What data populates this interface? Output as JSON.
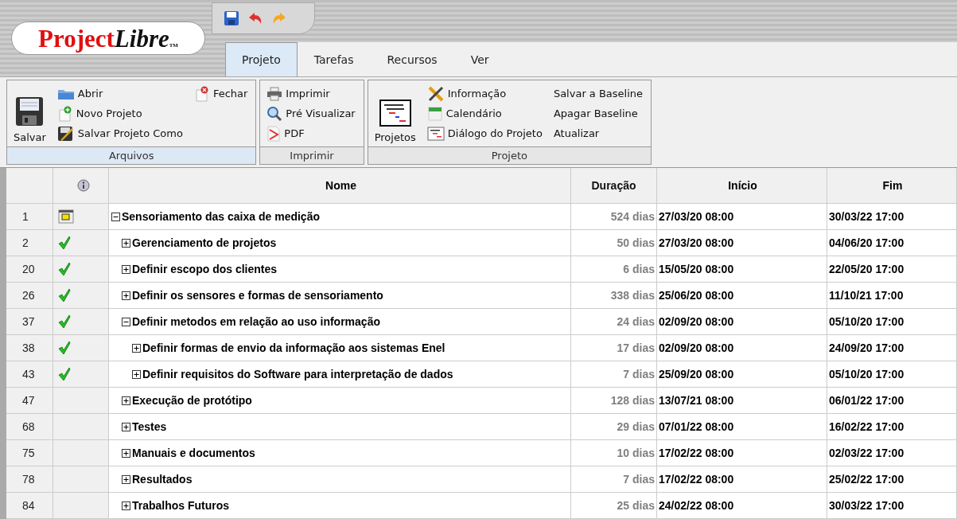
{
  "logo": {
    "first": "Project",
    "second": "Libre",
    "mark": "TM"
  },
  "tabs": [
    {
      "label": "Projeto",
      "selected": true
    },
    {
      "label": "Tarefas",
      "selected": false
    },
    {
      "label": "Recursos",
      "selected": false
    },
    {
      "label": "Ver",
      "selected": false
    }
  ],
  "ribbon": {
    "groups": [
      {
        "label": "Arquivos",
        "large": "Salvar",
        "columns": [
          [
            "Abrir",
            "Novo Projeto",
            "Salvar Projeto Como"
          ],
          [
            "Fechar"
          ]
        ]
      },
      {
        "label": "Imprimir",
        "columns": [
          [
            "Imprimir",
            "Pré Visualizar",
            "PDF"
          ]
        ]
      },
      {
        "label": "Projeto",
        "large": "Projetos",
        "columns": [
          [
            "Informação",
            "Calendário",
            "Diálogo do Projeto"
          ],
          [
            "Salvar a Baseline",
            "Apagar Baseline",
            "Atualizar"
          ]
        ]
      }
    ]
  },
  "table": {
    "columns": [
      "Nome",
      "Duração",
      "Início",
      "Fim"
    ],
    "rows": [
      {
        "id": "1",
        "kind": "calendar",
        "name": "Sensoriamento das caixa de medição",
        "expanded": true,
        "duration": "524 dias",
        "start": "27/03/20 08:00",
        "finish": "30/03/22 17:00",
        "children": [
          {
            "id": "2",
            "kind": "done",
            "name": "Gerenciamento de projetos",
            "expanded": false,
            "duration": "50 dias",
            "start": "27/03/20 08:00",
            "finish": "04/06/20 17:00"
          },
          {
            "id": "20",
            "kind": "done",
            "name": "Definir escopo dos clientes",
            "expanded": false,
            "duration": "6 dias",
            "start": "15/05/20 08:00",
            "finish": "22/05/20 17:00"
          },
          {
            "id": "26",
            "kind": "done",
            "name": "Definir os sensores e formas de sensoriamento",
            "expanded": false,
            "duration": "338 dias",
            "start": "25/06/20 08:00",
            "finish": "11/10/21 17:00"
          },
          {
            "id": "37",
            "kind": "done",
            "name": "Definir metodos em relação ao uso informação",
            "expanded": true,
            "duration": "24 dias",
            "start": "02/09/20 08:00",
            "finish": "05/10/20 17:00",
            "children": [
              {
                "id": "38",
                "kind": "done",
                "name": "Definir formas de envio da informação aos sistemas Enel",
                "expanded": false,
                "duration": "17 dias",
                "start": "02/09/20 08:00",
                "finish": "24/09/20 17:00"
              },
              {
                "id": "43",
                "kind": "done",
                "name": "Definir requisitos do Software para interpretação de dados",
                "expanded": false,
                "duration": "7 dias",
                "start": "25/09/20 08:00",
                "finish": "05/10/20 17:00"
              }
            ]
          },
          {
            "id": "47",
            "name": "Execução de protótipo",
            "expanded": false,
            "duration": "128 dias",
            "start": "13/07/21 08:00",
            "finish": "06/01/22 17:00"
          },
          {
            "id": "68",
            "name": "Testes",
            "expanded": false,
            "duration": "29 dias",
            "start": "07/01/22 08:00",
            "finish": "16/02/22 17:00"
          },
          {
            "id": "75",
            "name": "Manuais e documentos",
            "expanded": false,
            "duration": "10 dias",
            "start": "17/02/22 08:00",
            "finish": "02/03/22 17:00"
          },
          {
            "id": "78",
            "name": "Resultados",
            "expanded": false,
            "duration": "7 dias",
            "start": "17/02/22 08:00",
            "finish": "25/02/22 17:00"
          },
          {
            "id": "84",
            "name": "Trabalhos Futuros",
            "expanded": false,
            "duration": "25 dias",
            "start": "24/02/22 08:00",
            "finish": "30/03/22 17:00"
          }
        ]
      }
    ]
  }
}
